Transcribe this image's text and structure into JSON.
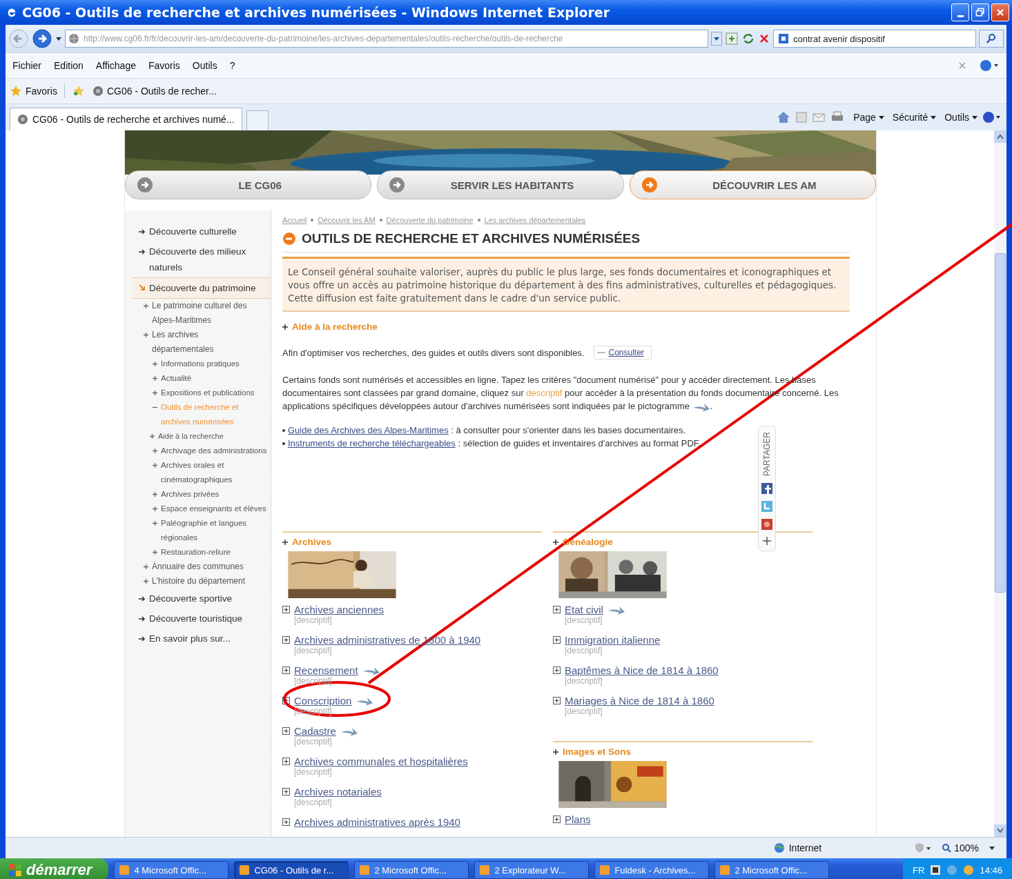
{
  "window": {
    "title": "CG06 - Outils de recherche et archives numérisées - Windows Internet Explorer"
  },
  "address_bar": {
    "url": "http://www.cg06.fr/fr/decouvrir-les-am/decouverte-du-patrimoine/les-archives-departementales/outils-recherche/outils-de-recherche"
  },
  "search": {
    "value": "contrat avenir dispositif"
  },
  "menu": [
    "Fichier",
    "Edition",
    "Affichage",
    "Favoris",
    "Outils",
    "?"
  ],
  "favorites_bar": {
    "label": "Favoris",
    "items": [
      "CG06 - Outils de recher..."
    ]
  },
  "tabs": [
    {
      "label": "CG06 - Outils de recherche et archives numé...",
      "selected": true
    }
  ],
  "command_bar": [
    "Page",
    "Sécurité",
    "Outils"
  ],
  "site_nav": [
    {
      "label": "LE CG06",
      "selected": false
    },
    {
      "label": "SERVIR LES HABITANTS",
      "selected": false
    },
    {
      "label": "DÉCOUVRIR LES AM",
      "selected": true
    }
  ],
  "sidebar": {
    "items": [
      {
        "label": "Découverte culturelle",
        "selected": false
      },
      {
        "label": "Découverte des milieux naturels",
        "selected": false
      },
      {
        "label": "Découverte du patrimoine",
        "selected": true,
        "children": [
          {
            "label": "Le patrimoine culturel des Alpes-Maritimes",
            "selected": false
          },
          {
            "label": "Les archives départementales",
            "selected": false,
            "children": [
              {
                "label": "Informations pratiques",
                "selected": false
              },
              {
                "label": "Actualité",
                "selected": false
              },
              {
                "label": "Expositions et publications",
                "selected": false
              },
              {
                "label": "Outils de recherche et archives numérisées",
                "selected": true,
                "children": [
                  {
                    "label": "Aide à la recherche",
                    "selected": false
                  }
                ]
              },
              {
                "label": "Archivage des administrations",
                "selected": false
              },
              {
                "label": "Archives orales et cinématographiques",
                "selected": false
              },
              {
                "label": "Archives privées",
                "selected": false
              },
              {
                "label": "Espace enseignants et élèves",
                "selected": false
              },
              {
                "label": "Paléographie et langues régionales",
                "selected": false
              },
              {
                "label": "Restauration-reliure",
                "selected": false
              }
            ]
          },
          {
            "label": "Annuaire des communes",
            "selected": false
          },
          {
            "label": "L'histoire du département",
            "selected": false
          }
        ]
      },
      {
        "label": "Découverte sportive",
        "selected": false
      },
      {
        "label": "Découverte touristique",
        "selected": false
      },
      {
        "label": "En savoir plus sur...",
        "selected": false
      }
    ]
  },
  "breadcrumb": [
    "Accueil",
    "Découvrir les AM",
    "Découverte du patrimoine",
    "Les archives départementales"
  ],
  "heading": "OUTILS DE RECHERCHE ET ARCHIVES NUMÉRISÉES",
  "intro": "Le Conseil général souhaite valoriser, auprès du public le plus large, ses fonds documentaires et iconographiques et vous offre un accès au patrimoine historique du département à des fins administratives, culturelles et pédagogiques. Cette diffusion est faite gratuitement dans le cadre d'un service public.",
  "aide": {
    "title": "Aide à la recherche",
    "text": "Afin d'optimiser vos recherches, des guides et outils divers sont disponibles.",
    "button": "Consulter"
  },
  "paragraph": {
    "before": "Certains fonds sont numérisés et accessibles en ligne. Tapez les critères \"document numérisé\" pour y accéder directement. Les bases documentaires sont classées par grand domaine, cliquez sur",
    "link": "descriptif",
    "after": "pour accéder à la présentation du fonds documentaire concerné. Les applications spécifiques développées autour d'archives numérisées sont indiquées par le pictogramme",
    "end": "."
  },
  "links": [
    {
      "link": "Guide des Archives des Alpes-Maritimes",
      "text": " : à consulter pour s'orienter dans les bases documentaires."
    },
    {
      "link": "Instruments de recherche téléchargeables",
      "text": " : sélection de guides et inventaires d'archives au format PDF."
    }
  ],
  "columns": [
    {
      "sections": [
        {
          "title": "Archives",
          "items": [
            {
              "label": "Archives anciennes",
              "digital": false,
              "note": "[descriptif]"
            },
            {
              "label": "Archives administratives de 1800 à 1940",
              "digital": false,
              "note": "[descriptif]"
            },
            {
              "label": "Recensement",
              "digital": true,
              "note": "[descriptif]"
            },
            {
              "label": "Conscription",
              "digital": true,
              "note": "[descriptif]"
            },
            {
              "label": "Cadastre",
              "digital": true,
              "note": "[descriptif]"
            },
            {
              "label": "Archives communales et hospitalières",
              "digital": false,
              "note": "[descriptif]"
            },
            {
              "label": "Archives notariales",
              "digital": false,
              "note": "[descriptif]"
            },
            {
              "label": "Archives administratives après 1940",
              "digital": false
            }
          ]
        }
      ]
    },
    {
      "sections": [
        {
          "title": "Généalogie",
          "items": [
            {
              "label": "Etat civil",
              "digital": true,
              "note": "[descriptif]"
            },
            {
              "label": "Immigration italienne",
              "digital": false,
              "note": "[descriptif]"
            },
            {
              "label": "Baptêmes à Nice de 1814 à 1860",
              "digital": false,
              "note": "[descriptif]"
            },
            {
              "label": "Mariages à Nice de 1814 à 1860",
              "digital": false,
              "note": "[descriptif]"
            }
          ]
        },
        {
          "title": "Images et Sons",
          "items": [
            {
              "label": "Plans",
              "digital": false
            }
          ]
        }
      ]
    }
  ],
  "share": {
    "label": "PARTAGER"
  },
  "status_bar": {
    "zone": "Internet",
    "zoom": "100%"
  },
  "taskbar": {
    "start": "démarrer",
    "items": [
      {
        "label": "4 Microsoft Offic...",
        "selected": false
      },
      {
        "label": "CG06 - Outils de r...",
        "selected": true
      },
      {
        "label": "2 Microsoft Offic...",
        "selected": false
      },
      {
        "label": "2 Explorateur W...",
        "selected": false
      },
      {
        "label": "Fuldesk - Archives...",
        "selected": false
      },
      {
        "label": "2 Microsoft Offic...",
        "selected": false
      }
    ],
    "language": "FR",
    "clock": "14:46"
  }
}
